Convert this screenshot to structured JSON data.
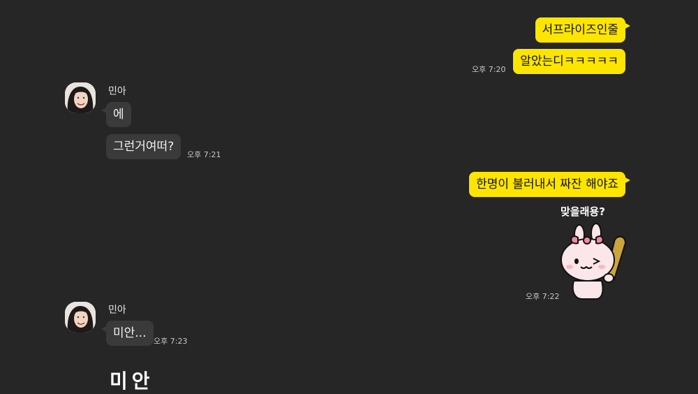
{
  "messages": {
    "out1": {
      "text": "서프라이즈인줄"
    },
    "out2": {
      "text": "알았는디ㅋㅋㅋㅋㅋ",
      "time": "오후 7:20"
    },
    "in_group1": {
      "sender": "민아",
      "msg1": "에",
      "msg2": "그런거여떠?",
      "time": "오후 7:21"
    },
    "out3": {
      "text": "한명이 불러내서 짜잔 해야죠"
    },
    "sticker": {
      "caption": "맞을래용?",
      "time": "오후 7:22",
      "icon": "bunny-with-bat-sticker"
    },
    "in_group2": {
      "sender": "민아",
      "msg1": "미안...",
      "time": "오후 7:23",
      "sticker_text": "미안"
    }
  },
  "colors": {
    "background": "#262626",
    "outgoing_bubble": "#fee500",
    "incoming_bubble": "#3a3a3a"
  }
}
